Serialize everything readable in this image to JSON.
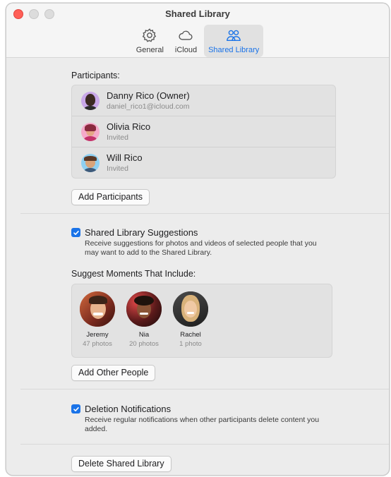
{
  "window": {
    "title": "Shared Library"
  },
  "tabs": [
    {
      "label": "General",
      "icon": "gear-icon"
    },
    {
      "label": "iCloud",
      "icon": "cloud-icon"
    },
    {
      "label": "Shared Library",
      "icon": "people-icon",
      "active": true
    }
  ],
  "participants": {
    "label": "Participants:",
    "items": [
      {
        "name": "Danny Rico (Owner)",
        "sub": "daniel_rico1@icloud.com"
      },
      {
        "name": "Olivia Rico",
        "sub": "Invited"
      },
      {
        "name": "Will Rico",
        "sub": "Invited"
      }
    ],
    "add_button": "Add Participants"
  },
  "suggestions": {
    "title": "Shared Library Suggestions",
    "checked": true,
    "description": "Receive suggestions for photos and videos of selected people that you may want to add to the Shared Library."
  },
  "moments": {
    "label": "Suggest Moments That Include:",
    "people": [
      {
        "name": "Jeremy",
        "count": "47 photos"
      },
      {
        "name": "Nia",
        "count": "20 photos"
      },
      {
        "name": "Rachel",
        "count": "1 photo"
      }
    ],
    "add_button": "Add Other People"
  },
  "deletion": {
    "title": "Deletion Notifications",
    "checked": true,
    "description": "Receive regular notifications when other participants delete content you added."
  },
  "delete_button": "Delete Shared Library",
  "colors": {
    "accent": "#1a73e8",
    "close": "#ff5f57"
  }
}
